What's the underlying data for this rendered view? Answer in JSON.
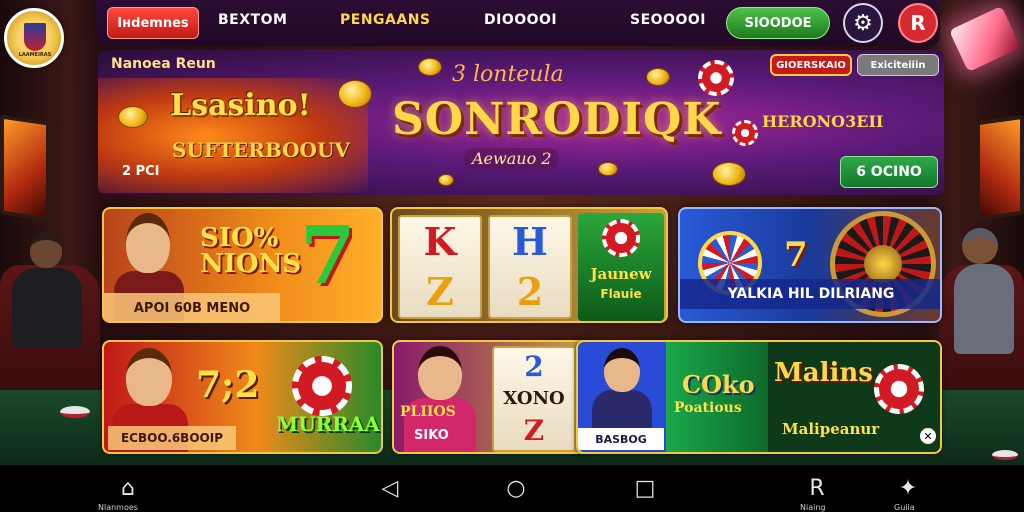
{
  "topbar": {
    "tabs": [
      "Iнdemnes",
      "BEXTOM",
      "PENGAANS",
      "DIOOOOI",
      "SEOOOOI"
    ],
    "deposit_label": "SIOODOE",
    "settings_icon": "gear-icon",
    "profile_icon": "profile-icon",
    "logo_text": "LAAMEIRAS"
  },
  "banner": {
    "subtitle": "Nanoea Reun",
    "logo_line1": "Lsasino!",
    "logo_line2": "SUFTERBOOUV",
    "small_text": "2 PCI",
    "script_text": "3 lonteula",
    "headline": "SONRODIQK",
    "headline_sub": "Aewauo 2",
    "pill_red": "GIOERSKAIO",
    "pill_gray": "Exiciteiiin",
    "promo_text": "HERONO3EII",
    "play_button": "6 OCINO"
  },
  "games": [
    {
      "title": "SIO% NIONS",
      "caption": "APOI 60B MENO",
      "symbol": "7"
    },
    {
      "title": "Jaunew",
      "caption": "Flauie",
      "reels": [
        "K",
        "Z",
        "H",
        "2"
      ]
    },
    {
      "title": "YALKIA HIL DILRIANG",
      "symbol": "7"
    },
    {
      "title": "7;2",
      "subtitle": "MURRAA",
      "caption": "ECBOO.6BOOIP"
    },
    {
      "title": "PLIIOS",
      "caption": "SIKO",
      "reels": [
        "2",
        "XONO",
        "Z"
      ]
    },
    {
      "title": "COko",
      "title2": "Poatious",
      "caption": "BASBOG",
      "promo": "Malins",
      "promo2": "Malipeanur"
    }
  ],
  "navbar": {
    "items": [
      {
        "icon": "home-icon",
        "caption": "Nlanmoes"
      },
      {
        "icon": "back-icon",
        "caption": ""
      },
      {
        "icon": "home-circle-icon",
        "caption": ""
      },
      {
        "icon": "recents-icon",
        "caption": ""
      },
      {
        "icon": "r-icon",
        "caption": "Niaing"
      },
      {
        "icon": "puzzle-icon",
        "caption": "Guiia"
      }
    ],
    "glyphs": [
      "⌂",
      "◁",
      "○",
      "□",
      "R",
      "✦"
    ]
  },
  "colors": {
    "accent_red": "#c01818",
    "accent_green": "#1f7a1e",
    "gold": "#f5c640",
    "banner_purple": "#5a1a78"
  }
}
